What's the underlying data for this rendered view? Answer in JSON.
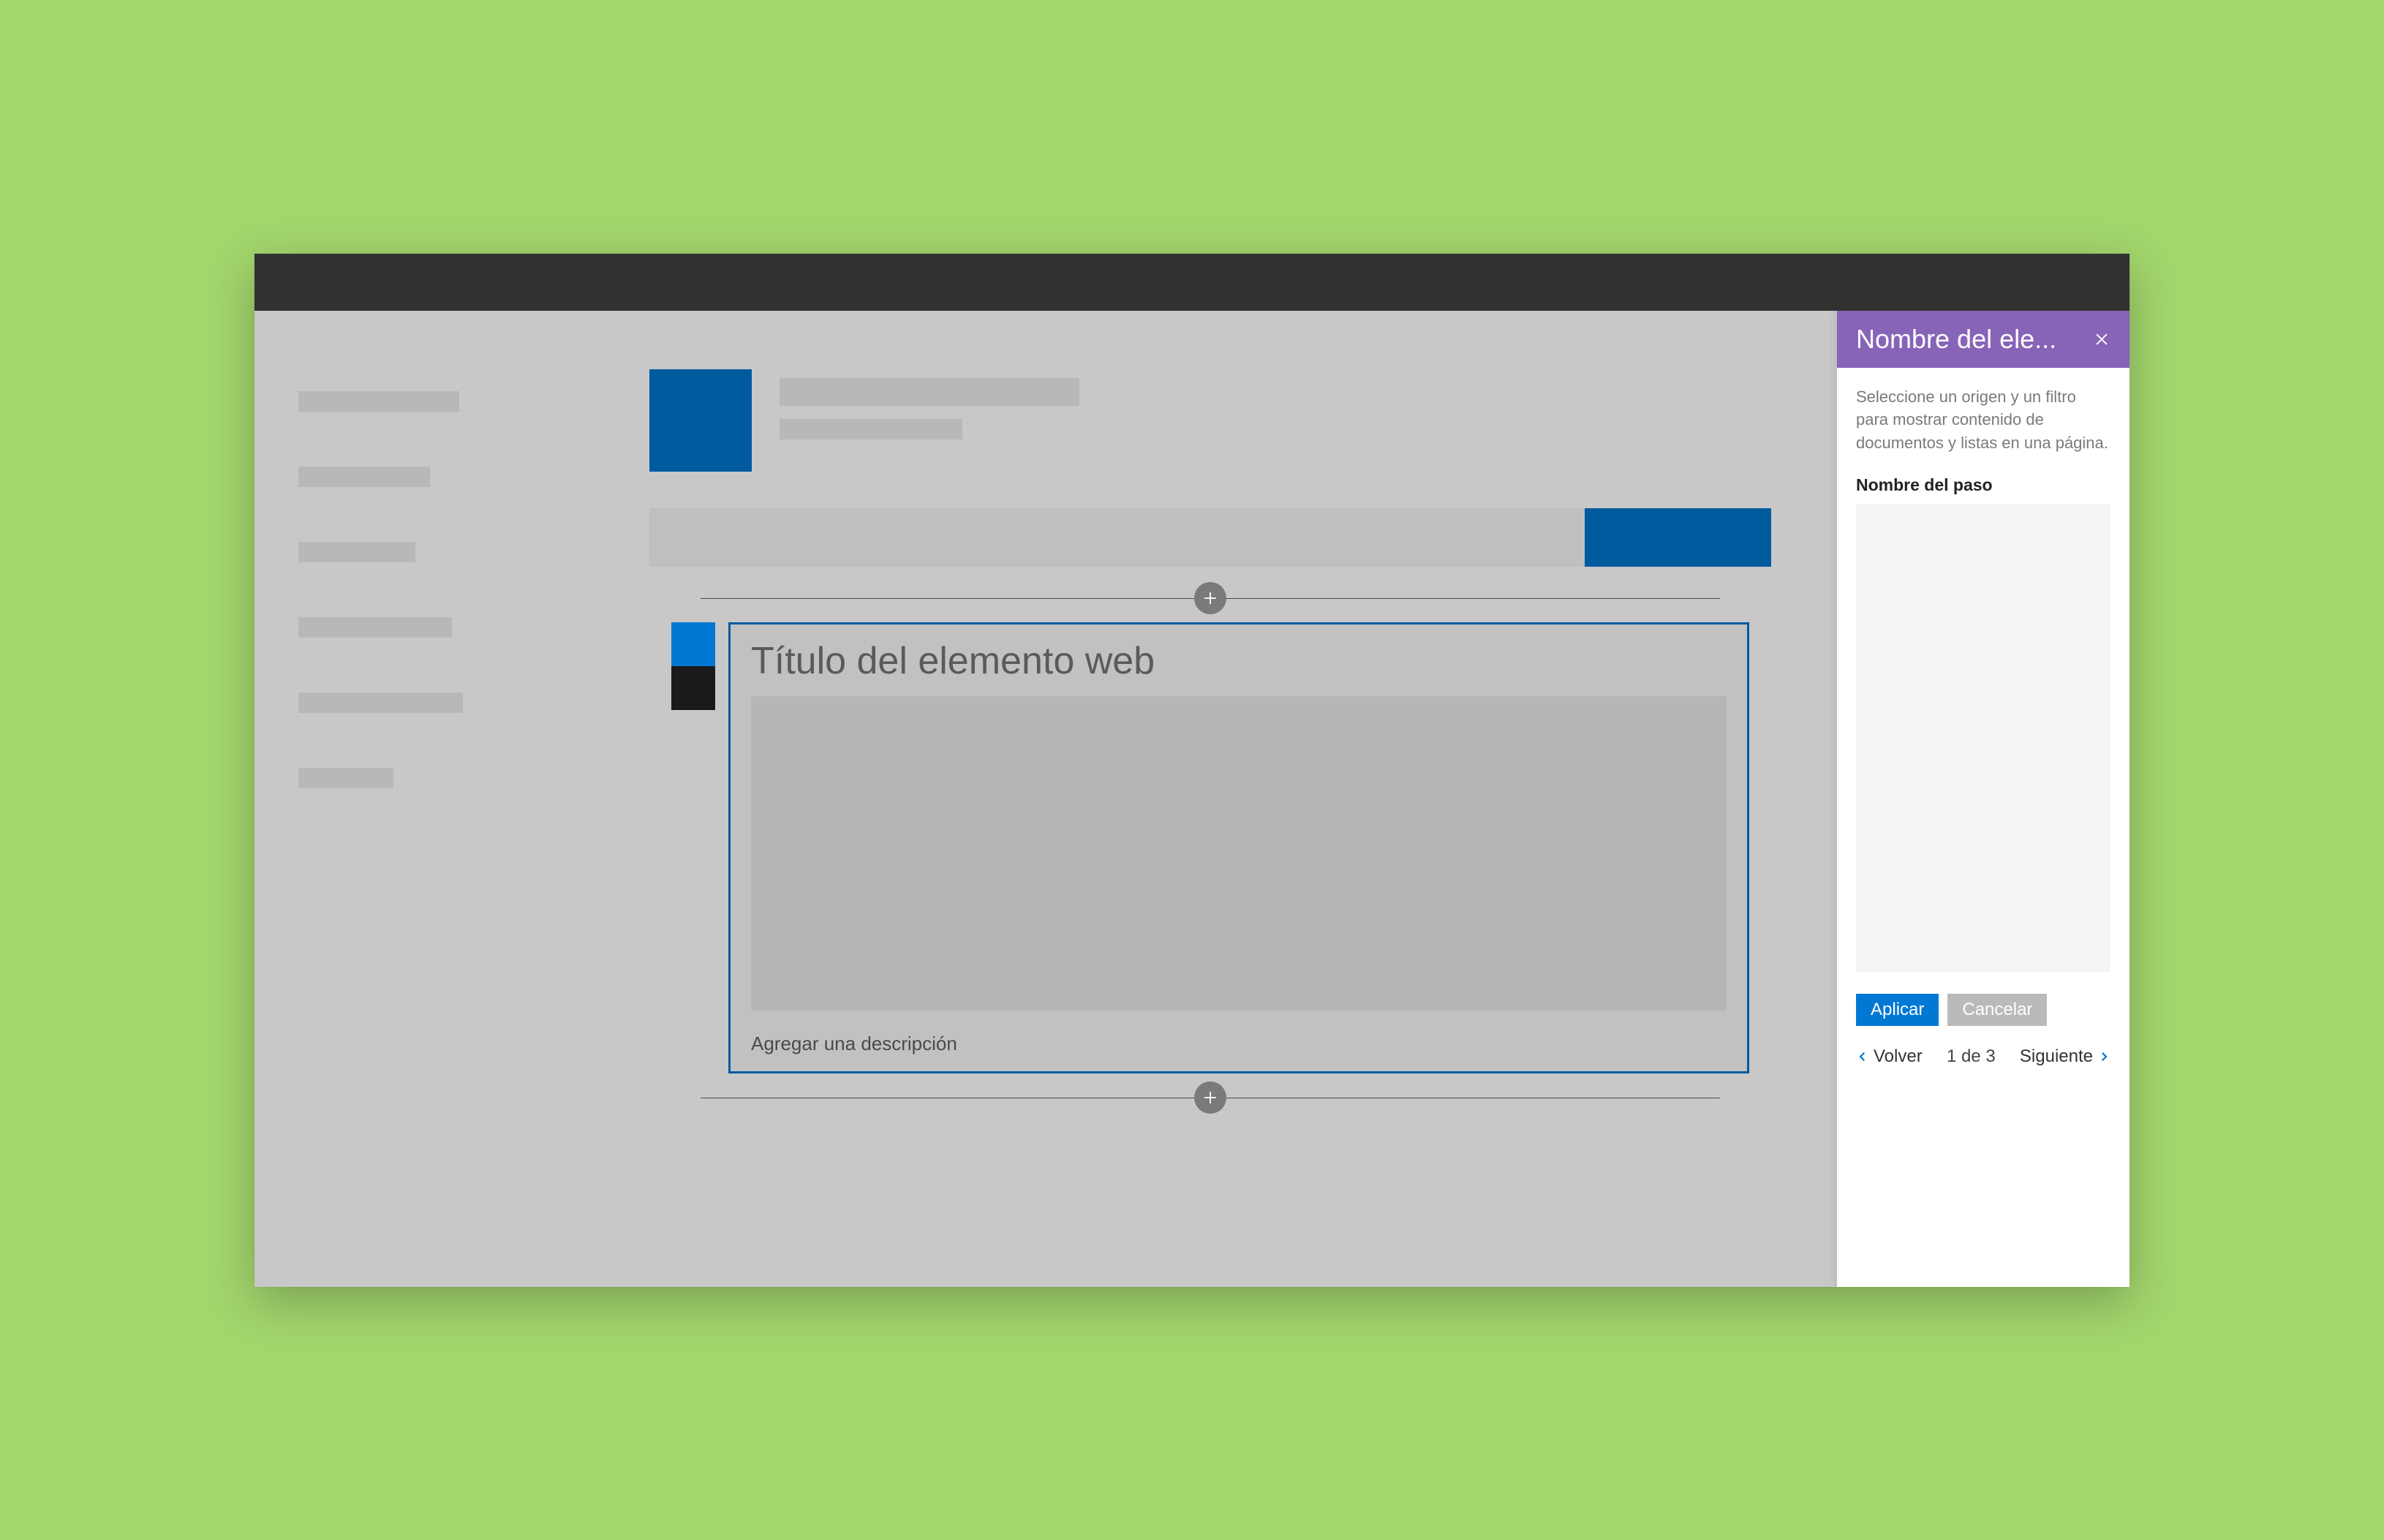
{
  "colors": {
    "background": "#a3d66d",
    "accent": "#0078d4",
    "brand": "#005a9e",
    "panelHeader": "#8764b8"
  },
  "webpart": {
    "title": "Título del elemento web",
    "description_placeholder": "Agregar una descripción"
  },
  "panel": {
    "title": "Nombre del ele...",
    "description": "Seleccione un origen y un filtro para mostrar contenido de documentos y listas en una página.",
    "step_label": "Nombre del paso",
    "apply": "Aplicar",
    "cancel": "Cancelar",
    "back": "Volver",
    "page": "1 de 3",
    "next": "Siguiente"
  }
}
